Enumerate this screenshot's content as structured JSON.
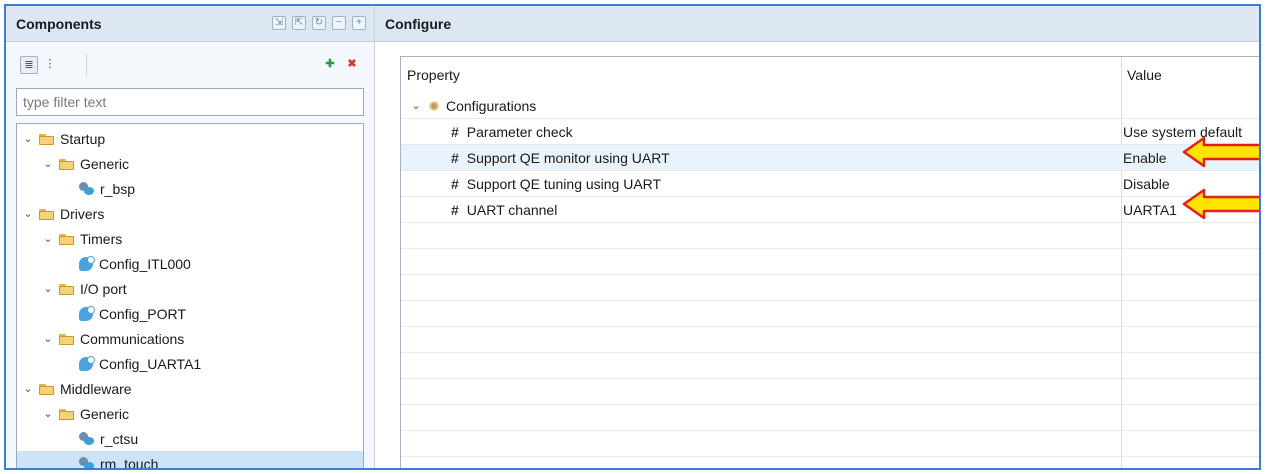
{
  "components": {
    "title": "Components",
    "filter_placeholder": "type filter text",
    "tree": [
      {
        "label": "Startup",
        "kind": "folder",
        "level": 0
      },
      {
        "label": "Generic",
        "kind": "folder",
        "level": 1
      },
      {
        "label": "r_bsp",
        "kind": "module",
        "level": 2
      },
      {
        "label": "Drivers",
        "kind": "folder",
        "level": 0
      },
      {
        "label": "Timers",
        "kind": "folder",
        "level": 1
      },
      {
        "label": "Config_ITL000",
        "kind": "config",
        "level": 2
      },
      {
        "label": "I/O port",
        "kind": "folder",
        "level": 1
      },
      {
        "label": "Config_PORT",
        "kind": "config",
        "level": 2
      },
      {
        "label": "Communications",
        "kind": "folder",
        "level": 1
      },
      {
        "label": "Config_UARTA1",
        "kind": "config",
        "level": 2
      },
      {
        "label": "Middleware",
        "kind": "folder",
        "level": 0
      },
      {
        "label": "Generic",
        "kind": "folder",
        "level": 1
      },
      {
        "label": "r_ctsu",
        "kind": "module",
        "level": 2
      },
      {
        "label": "rm_touch",
        "kind": "module",
        "level": 2,
        "selected": true
      }
    ]
  },
  "configure": {
    "title": "Configure",
    "col_property": "Property",
    "col_value": "Value",
    "group": "Configurations",
    "rows": [
      {
        "property": "Parameter check",
        "value": "Use system default"
      },
      {
        "property": "Support QE monitor using UART",
        "value": "Enable",
        "highlighted": true,
        "arrow": true
      },
      {
        "property": "Support QE tuning using UART",
        "value": "Disable"
      },
      {
        "property": "UART channel",
        "value": "UARTA1",
        "arrow": true
      }
    ]
  },
  "colors": {
    "accent_border": "#3a7fd5",
    "header_bg": "#dce7f3",
    "selection": "#cde4f7",
    "arrow_fill": "#ffe400",
    "arrow_stroke": "#e02020"
  }
}
